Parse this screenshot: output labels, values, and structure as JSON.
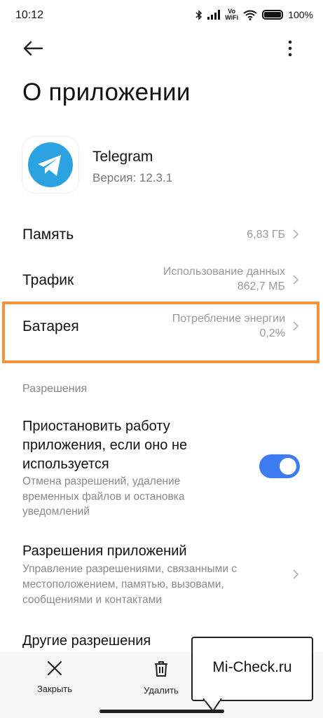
{
  "status_bar": {
    "time": "10:12",
    "vowifi": "Vo\nWiFi",
    "battery": "100%"
  },
  "header": {
    "title": "О приложении"
  },
  "app": {
    "name": "Telegram",
    "version": "Версия: 12.3.1"
  },
  "rows": {
    "memory": {
      "label": "Память",
      "value": "6,83 ГБ"
    },
    "traffic": {
      "label": "Трафик",
      "value_line1": "Использование данных",
      "value_line2": "862,7 МБ"
    },
    "battery": {
      "label": "Батарея",
      "value_line1": "Потребление энергии",
      "value_line2": "0,2%"
    }
  },
  "permissions": {
    "section_title": "Разрешения",
    "pause_title": "Приостановить работу приложения, если оно не используется",
    "pause_desc": "Отмена разрешений, удаление временных файлов и остановка уведомлений",
    "pause_enabled": true,
    "app_perm_title": "Разрешения приложений",
    "app_perm_desc": "Управление разрешениями, связанными с местоположением, памятью, вызовами, сообщениями и контактами",
    "other_title": "Другие разрешения"
  },
  "bottom_bar": {
    "close_label": "Закрыть",
    "delete_label": "Удалить"
  },
  "watermark": {
    "text": "Mi-Check.ru"
  },
  "colors": {
    "highlight": "#f4923a",
    "toggle": "#3e7bf0",
    "telegram": "#2aa3e0"
  }
}
